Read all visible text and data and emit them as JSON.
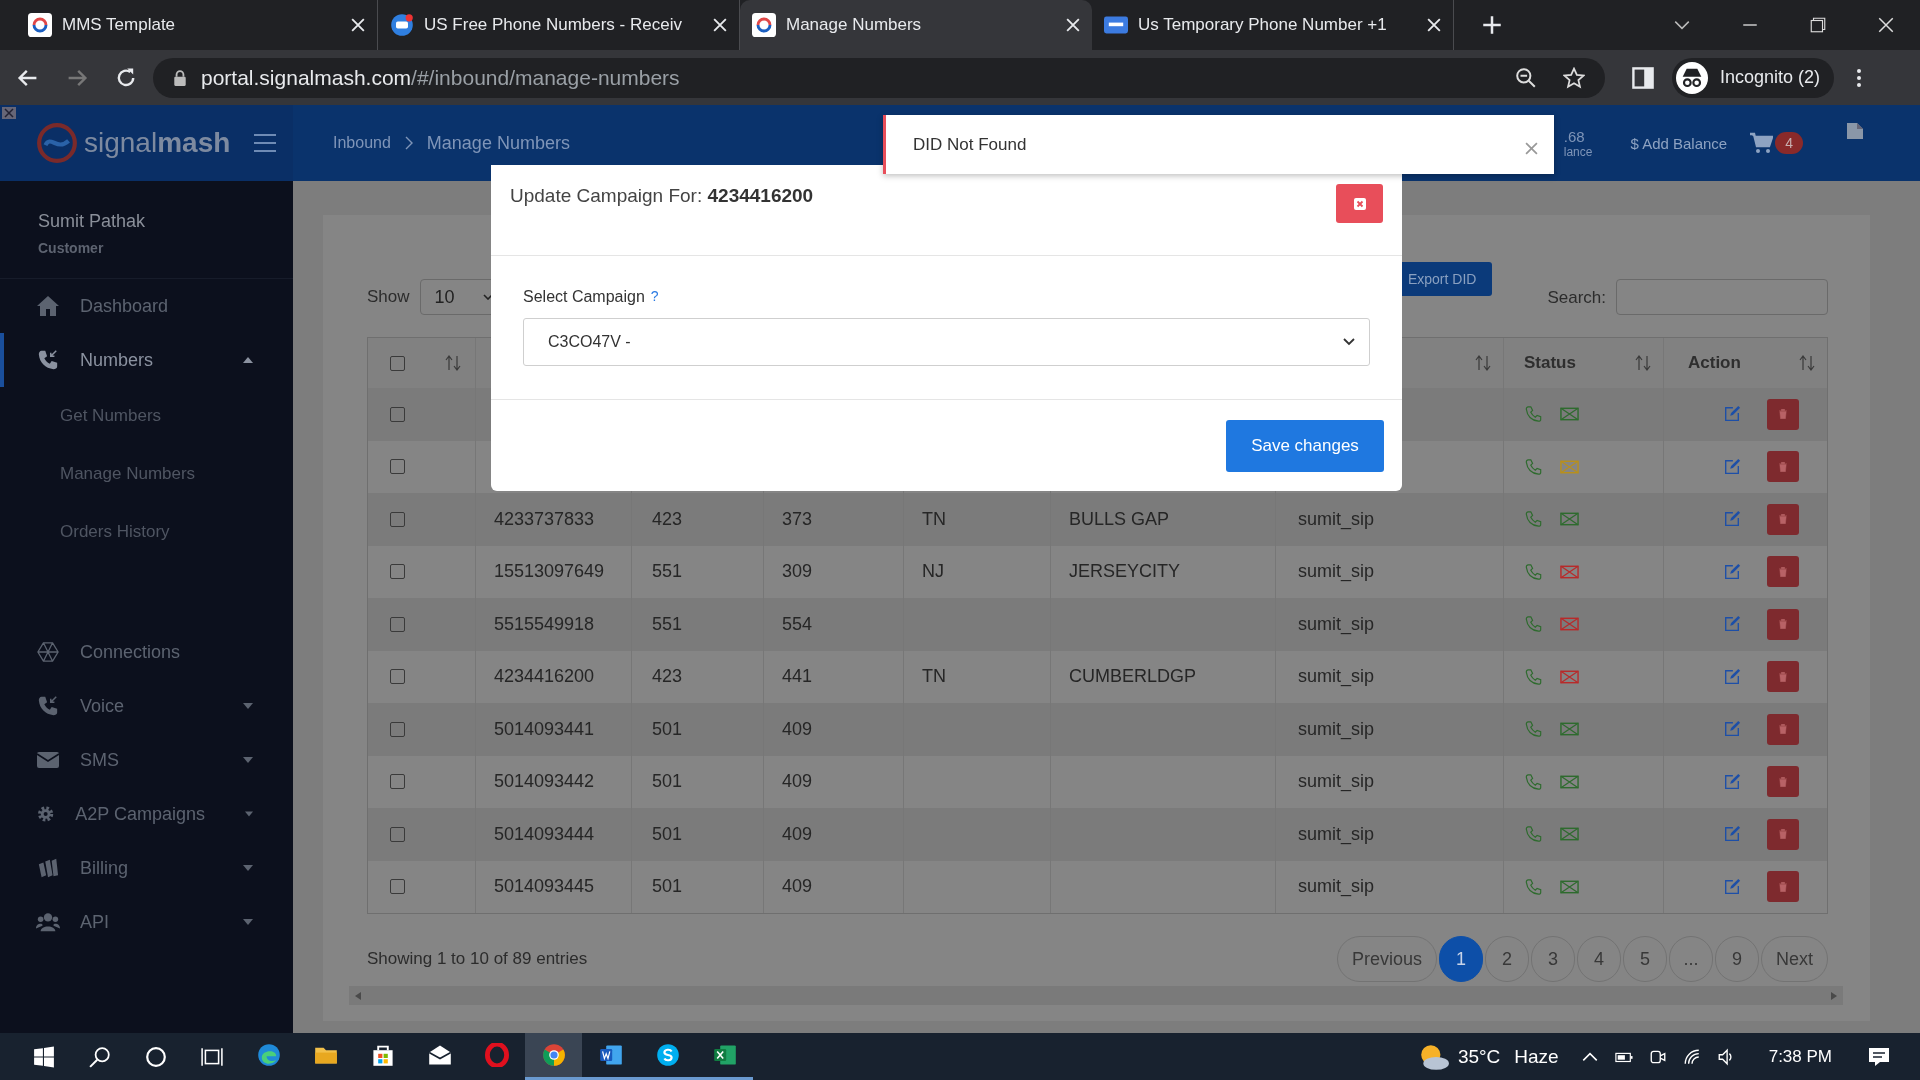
{
  "browser": {
    "tabs": [
      {
        "title": "MMS Template",
        "kind": "signalmash",
        "selected": false
      },
      {
        "title": "US Free Phone Numbers - Receiv",
        "kind": "chat",
        "selected": false
      },
      {
        "title": "Manage Numbers",
        "kind": "signalmash",
        "selected": true
      },
      {
        "title": "Us Temporary Phone Number +1",
        "kind": "sms",
        "selected": false
      }
    ],
    "url_host": "portal.signalmash.com",
    "url_path": "/#/inbound/manage-numbers",
    "profile": "Incognito (2)"
  },
  "header": {
    "logo_light": "signal",
    "logo_bold": "mash",
    "breadcrumb": [
      "Inbound",
      "Manage Numbers"
    ],
    "balance_fragment": ".68",
    "balance_label_fragment": "lance",
    "add_balance": "$ Add Balance",
    "cart_count": "4"
  },
  "sidebar": {
    "user_name": "Sumit Pathak",
    "role": "Customer",
    "items": [
      {
        "label": "Dashboard",
        "kind": "home",
        "selected": false
      },
      {
        "label": "Numbers",
        "kind": "phone",
        "selected": true,
        "expanded": true,
        "children": [
          {
            "label": "Get Numbers"
          },
          {
            "label": "Manage Numbers"
          },
          {
            "label": "Orders History"
          }
        ]
      },
      {
        "label": "Connections",
        "kind": "network",
        "selected": false
      },
      {
        "label": "Voice",
        "kind": "phone",
        "selected": false,
        "expanded": false
      },
      {
        "label": "SMS",
        "kind": "mail",
        "selected": false,
        "expanded": false
      },
      {
        "label": "A2P Campaigns",
        "kind": "gear",
        "selected": false,
        "expanded": false
      },
      {
        "label": "Billing",
        "kind": "billing",
        "selected": false,
        "expanded": false
      },
      {
        "label": "API",
        "kind": "users",
        "selected": false,
        "expanded": false
      }
    ]
  },
  "content": {
    "show_label": "Show",
    "page_length": "10",
    "export_button": "Export DID",
    "search_label": "Search:",
    "table": {
      "select_all_checked": false,
      "status_header": "Status",
      "action_header": "Action",
      "rows": [
        {
          "checked": false,
          "color": "#2e6b2e"
        },
        {
          "checked": false,
          "color": "#b8901c"
        },
        {
          "checked": false,
          "number": "4233737833",
          "npa": "423",
          "nxx": "373",
          "state": "TN",
          "city": "BULLS GAP",
          "user": "sumit_sip",
          "color": "#2e6b2e"
        },
        {
          "checked": false,
          "number": "15513097649",
          "npa": "551",
          "nxx": "309",
          "state": "NJ",
          "city": "JERSEYCITY",
          "user": "sumit_sip",
          "color": "#b82a2a"
        },
        {
          "checked": false,
          "number": "5515549918",
          "npa": "551",
          "nxx": "554",
          "user": "sumit_sip",
          "color": "#b82a2a"
        },
        {
          "checked": false,
          "number": "4234416200",
          "npa": "423",
          "nxx": "441",
          "state": "TN",
          "city": "CUMBERLDGP",
          "user": "sumit_sip",
          "color": "#b82a2a"
        },
        {
          "checked": false,
          "number": "5014093441",
          "npa": "501",
          "nxx": "409",
          "user": "sumit_sip",
          "color": "#2e6b2e"
        },
        {
          "checked": false,
          "number": "5014093442",
          "npa": "501",
          "nxx": "409",
          "user": "sumit_sip",
          "color": "#2e6b2e"
        },
        {
          "checked": false,
          "number": "5014093444",
          "npa": "501",
          "nxx": "409",
          "user": "sumit_sip",
          "color": "#2e6b2e"
        },
        {
          "checked": false,
          "number": "5014093445",
          "npa": "501",
          "nxx": "409",
          "user": "sumit_sip",
          "color": "#2e6b2e"
        }
      ]
    },
    "info": "Showing 1 to 10 of 89 entries",
    "pages": [
      {
        "label": "Previous",
        "kind": "nav",
        "selected": false
      },
      {
        "label": "1",
        "kind": "page",
        "selected": true
      },
      {
        "label": "2",
        "kind": "page",
        "selected": false
      },
      {
        "label": "3",
        "kind": "page",
        "selected": false
      },
      {
        "label": "4",
        "kind": "page",
        "selected": false
      },
      {
        "label": "5",
        "kind": "page",
        "selected": false
      },
      {
        "label": "...",
        "kind": "page",
        "selected": false
      },
      {
        "label": "9",
        "kind": "page",
        "selected": false
      },
      {
        "label": "Next",
        "kind": "nav",
        "selected": false
      }
    ]
  },
  "toast": {
    "message": "DID Not Found"
  },
  "modal": {
    "title": "Update Campaign For: **4234416200**",
    "field_label": "Select Campaign",
    "help_mark": "?",
    "campaign_value": "C3CO47V -",
    "save_button": "Save changes"
  },
  "taskbar": {
    "apps": [
      {
        "kind": "edge",
        "running": false,
        "selected": false
      },
      {
        "kind": "folder",
        "running": false,
        "selected": false
      },
      {
        "kind": "store",
        "running": false,
        "selected": false
      },
      {
        "kind": "mail",
        "running": false,
        "selected": false
      },
      {
        "kind": "opera",
        "running": false,
        "selected": false
      },
      {
        "kind": "chrome",
        "running": true,
        "selected": true
      },
      {
        "kind": "word",
        "running": true,
        "selected": false
      },
      {
        "kind": "skype",
        "running": true,
        "selected": false
      },
      {
        "kind": "excel",
        "running": true,
        "selected": false
      }
    ],
    "temperature": "35°C",
    "weather": "Haze",
    "time": "7:38 PM"
  }
}
